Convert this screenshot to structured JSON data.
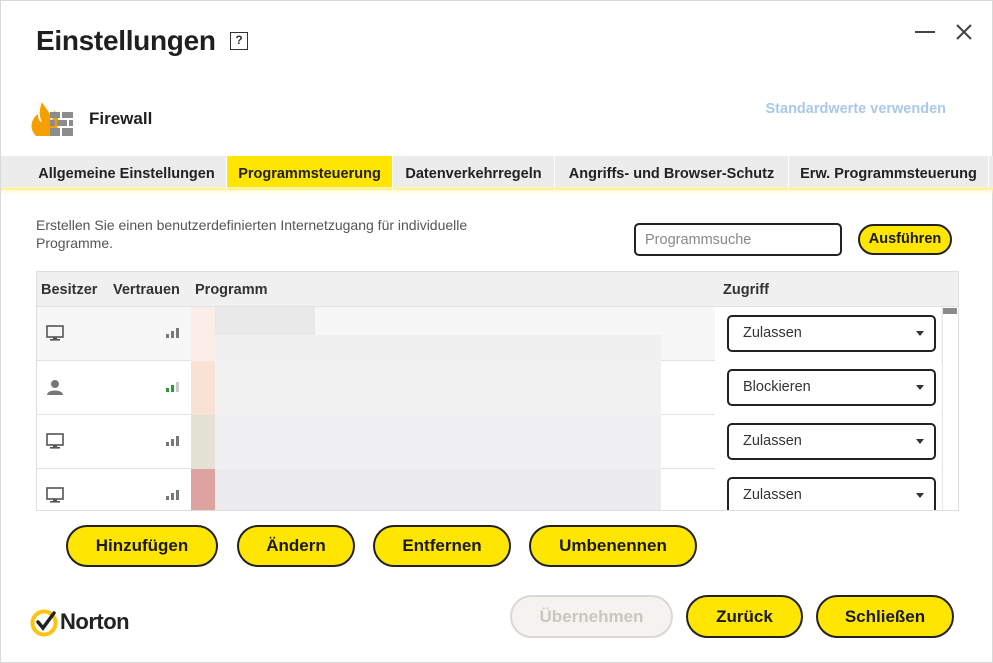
{
  "window": {
    "title": "Einstellungen",
    "help_glyph": "?"
  },
  "section": {
    "title": "Firewall",
    "defaults_link": "Standardwerte verwenden"
  },
  "tabs": [
    {
      "label": "Allgemeine Einstellungen",
      "active": false
    },
    {
      "label": "Programmsteuerung",
      "active": true
    },
    {
      "label": "Datenverkehrregeln",
      "active": false
    },
    {
      "label": "Angriffs- und Browser-Schutz",
      "active": false
    },
    {
      "label": "Erw. Programmsteuerung",
      "active": false
    }
  ],
  "description": "Erstellen Sie einen benutzerdefinierten Internetzugang für individuelle Programme.",
  "search": {
    "placeholder": "Programmsuche",
    "run_label": "Ausführen"
  },
  "table": {
    "columns": [
      "Besitzer",
      "Vertrauen",
      "Programm",
      "Zugriff"
    ],
    "rows": [
      {
        "owner_icon": "computer-icon",
        "trust_icon": "signal-bars-gray-icon",
        "program": "",
        "access": "Zulassen"
      },
      {
        "owner_icon": "user-icon",
        "trust_icon": "signal-bars-green-icon",
        "program": "",
        "access": "Blockieren"
      },
      {
        "owner_icon": "computer-icon",
        "trust_icon": "signal-bars-gray-icon",
        "program": "",
        "access": "Zulassen"
      },
      {
        "owner_icon": "computer-icon",
        "trust_icon": "signal-bars-gray-icon",
        "program": "",
        "access": "Zulassen"
      }
    ]
  },
  "actions": {
    "add": "Hinzufügen",
    "change": "Ändern",
    "remove": "Entfernen",
    "rename": "Umbenennen"
  },
  "footer": {
    "brand": "Norton",
    "apply": "Übernehmen",
    "back": "Zurück",
    "close": "Schließen"
  },
  "colors": {
    "accent_yellow": "#ffe600",
    "tab_bar": "#ececec",
    "link_disabled": "#a9c8ea",
    "trust_green": "#2e9b3a",
    "trust_gray": "#777777"
  }
}
